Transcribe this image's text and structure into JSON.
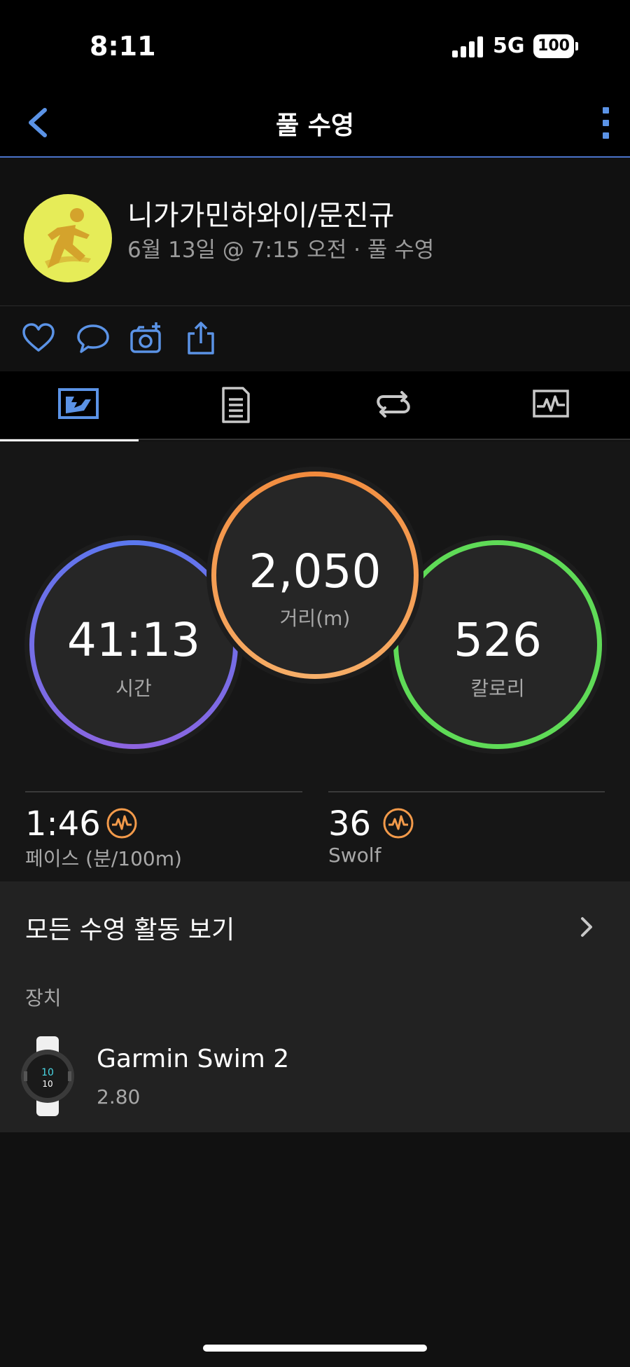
{
  "status_bar": {
    "time": "8:11",
    "network": "5G",
    "battery": "100"
  },
  "nav": {
    "title": "풀 수영",
    "back_icon": "chevron-left-icon",
    "more_icon": "more-vertical-icon"
  },
  "activity": {
    "name": "니가가민하와이/문진규",
    "subtitle": "6월 13일 @ 7:15 오전 · 풀 수영",
    "avatar_icon": "runner-icon",
    "avatar_color": "#e6ec58"
  },
  "social": {
    "icons": [
      "heart-icon",
      "comment-icon",
      "camera-add-icon",
      "share-icon"
    ]
  },
  "tabs": [
    {
      "icon": "stats-icon",
      "active": true
    },
    {
      "icon": "details-icon",
      "active": false
    },
    {
      "icon": "laps-icon",
      "active": false
    },
    {
      "icon": "chart-icon",
      "active": false
    }
  ],
  "stats": {
    "time": {
      "value": "41:13",
      "label": "시간",
      "color": "#6f86ef"
    },
    "distance": {
      "value": "2,050",
      "label": "거리(m)",
      "color": "#f39a4a"
    },
    "calories": {
      "value": "526",
      "label": "칼로리",
      "color": "#5fdb57"
    }
  },
  "metrics": [
    {
      "value": "1:46",
      "label": "페이스 (분/100m)",
      "icon": "heart-rate-icon"
    },
    {
      "value": "36",
      "label": "Swolf",
      "icon": "heart-rate-icon"
    }
  ],
  "all_swims": {
    "label": "모든 수영 활동 보기"
  },
  "device": {
    "heading": "장치",
    "name": "Garmin Swim 2",
    "version": "2.80"
  },
  "colors": {
    "accent": "#5b93e6",
    "metric_icon": "#f39a4a"
  }
}
